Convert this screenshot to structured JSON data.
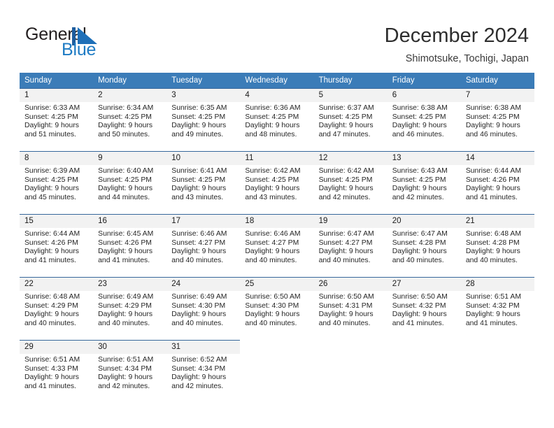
{
  "brand": {
    "name_part1": "General",
    "name_part2": "Blue",
    "logo_icon": "blue-triangle-flag-icon",
    "accent_color": "#1e7bc4"
  },
  "header": {
    "title": "December 2024",
    "subtitle": "Shimotsuke, Tochigi, Japan"
  },
  "theme": {
    "header_row_bg": "#3b7cb8",
    "day_number_bg": "#f2f2f2",
    "row_top_border": "#36679b",
    "page_bg": "#ffffff"
  },
  "weekday_headers": [
    "Sunday",
    "Monday",
    "Tuesday",
    "Wednesday",
    "Thursday",
    "Friday",
    "Saturday"
  ],
  "weeks": [
    [
      {
        "day": "1",
        "sunrise": "Sunrise: 6:33 AM",
        "sunset": "Sunset: 4:25 PM",
        "daylight1": "Daylight: 9 hours",
        "daylight2": "and 51 minutes."
      },
      {
        "day": "2",
        "sunrise": "Sunrise: 6:34 AM",
        "sunset": "Sunset: 4:25 PM",
        "daylight1": "Daylight: 9 hours",
        "daylight2": "and 50 minutes."
      },
      {
        "day": "3",
        "sunrise": "Sunrise: 6:35 AM",
        "sunset": "Sunset: 4:25 PM",
        "daylight1": "Daylight: 9 hours",
        "daylight2": "and 49 minutes."
      },
      {
        "day": "4",
        "sunrise": "Sunrise: 6:36 AM",
        "sunset": "Sunset: 4:25 PM",
        "daylight1": "Daylight: 9 hours",
        "daylight2": "and 48 minutes."
      },
      {
        "day": "5",
        "sunrise": "Sunrise: 6:37 AM",
        "sunset": "Sunset: 4:25 PM",
        "daylight1": "Daylight: 9 hours",
        "daylight2": "and 47 minutes."
      },
      {
        "day": "6",
        "sunrise": "Sunrise: 6:38 AM",
        "sunset": "Sunset: 4:25 PM",
        "daylight1": "Daylight: 9 hours",
        "daylight2": "and 46 minutes."
      },
      {
        "day": "7",
        "sunrise": "Sunrise: 6:38 AM",
        "sunset": "Sunset: 4:25 PM",
        "daylight1": "Daylight: 9 hours",
        "daylight2": "and 46 minutes."
      }
    ],
    [
      {
        "day": "8",
        "sunrise": "Sunrise: 6:39 AM",
        "sunset": "Sunset: 4:25 PM",
        "daylight1": "Daylight: 9 hours",
        "daylight2": "and 45 minutes."
      },
      {
        "day": "9",
        "sunrise": "Sunrise: 6:40 AM",
        "sunset": "Sunset: 4:25 PM",
        "daylight1": "Daylight: 9 hours",
        "daylight2": "and 44 minutes."
      },
      {
        "day": "10",
        "sunrise": "Sunrise: 6:41 AM",
        "sunset": "Sunset: 4:25 PM",
        "daylight1": "Daylight: 9 hours",
        "daylight2": "and 43 minutes."
      },
      {
        "day": "11",
        "sunrise": "Sunrise: 6:42 AM",
        "sunset": "Sunset: 4:25 PM",
        "daylight1": "Daylight: 9 hours",
        "daylight2": "and 43 minutes."
      },
      {
        "day": "12",
        "sunrise": "Sunrise: 6:42 AM",
        "sunset": "Sunset: 4:25 PM",
        "daylight1": "Daylight: 9 hours",
        "daylight2": "and 42 minutes."
      },
      {
        "day": "13",
        "sunrise": "Sunrise: 6:43 AM",
        "sunset": "Sunset: 4:25 PM",
        "daylight1": "Daylight: 9 hours",
        "daylight2": "and 42 minutes."
      },
      {
        "day": "14",
        "sunrise": "Sunrise: 6:44 AM",
        "sunset": "Sunset: 4:26 PM",
        "daylight1": "Daylight: 9 hours",
        "daylight2": "and 41 minutes."
      }
    ],
    [
      {
        "day": "15",
        "sunrise": "Sunrise: 6:44 AM",
        "sunset": "Sunset: 4:26 PM",
        "daylight1": "Daylight: 9 hours",
        "daylight2": "and 41 minutes."
      },
      {
        "day": "16",
        "sunrise": "Sunrise: 6:45 AM",
        "sunset": "Sunset: 4:26 PM",
        "daylight1": "Daylight: 9 hours",
        "daylight2": "and 41 minutes."
      },
      {
        "day": "17",
        "sunrise": "Sunrise: 6:46 AM",
        "sunset": "Sunset: 4:27 PM",
        "daylight1": "Daylight: 9 hours",
        "daylight2": "and 40 minutes."
      },
      {
        "day": "18",
        "sunrise": "Sunrise: 6:46 AM",
        "sunset": "Sunset: 4:27 PM",
        "daylight1": "Daylight: 9 hours",
        "daylight2": "and 40 minutes."
      },
      {
        "day": "19",
        "sunrise": "Sunrise: 6:47 AM",
        "sunset": "Sunset: 4:27 PM",
        "daylight1": "Daylight: 9 hours",
        "daylight2": "and 40 minutes."
      },
      {
        "day": "20",
        "sunrise": "Sunrise: 6:47 AM",
        "sunset": "Sunset: 4:28 PM",
        "daylight1": "Daylight: 9 hours",
        "daylight2": "and 40 minutes."
      },
      {
        "day": "21",
        "sunrise": "Sunrise: 6:48 AM",
        "sunset": "Sunset: 4:28 PM",
        "daylight1": "Daylight: 9 hours",
        "daylight2": "and 40 minutes."
      }
    ],
    [
      {
        "day": "22",
        "sunrise": "Sunrise: 6:48 AM",
        "sunset": "Sunset: 4:29 PM",
        "daylight1": "Daylight: 9 hours",
        "daylight2": "and 40 minutes."
      },
      {
        "day": "23",
        "sunrise": "Sunrise: 6:49 AM",
        "sunset": "Sunset: 4:29 PM",
        "daylight1": "Daylight: 9 hours",
        "daylight2": "and 40 minutes."
      },
      {
        "day": "24",
        "sunrise": "Sunrise: 6:49 AM",
        "sunset": "Sunset: 4:30 PM",
        "daylight1": "Daylight: 9 hours",
        "daylight2": "and 40 minutes."
      },
      {
        "day": "25",
        "sunrise": "Sunrise: 6:50 AM",
        "sunset": "Sunset: 4:30 PM",
        "daylight1": "Daylight: 9 hours",
        "daylight2": "and 40 minutes."
      },
      {
        "day": "26",
        "sunrise": "Sunrise: 6:50 AM",
        "sunset": "Sunset: 4:31 PM",
        "daylight1": "Daylight: 9 hours",
        "daylight2": "and 40 minutes."
      },
      {
        "day": "27",
        "sunrise": "Sunrise: 6:50 AM",
        "sunset": "Sunset: 4:32 PM",
        "daylight1": "Daylight: 9 hours",
        "daylight2": "and 41 minutes."
      },
      {
        "day": "28",
        "sunrise": "Sunrise: 6:51 AM",
        "sunset": "Sunset: 4:32 PM",
        "daylight1": "Daylight: 9 hours",
        "daylight2": "and 41 minutes."
      }
    ],
    [
      {
        "day": "29",
        "sunrise": "Sunrise: 6:51 AM",
        "sunset": "Sunset: 4:33 PM",
        "daylight1": "Daylight: 9 hours",
        "daylight2": "and 41 minutes."
      },
      {
        "day": "30",
        "sunrise": "Sunrise: 6:51 AM",
        "sunset": "Sunset: 4:34 PM",
        "daylight1": "Daylight: 9 hours",
        "daylight2": "and 42 minutes."
      },
      {
        "day": "31",
        "sunrise": "Sunrise: 6:52 AM",
        "sunset": "Sunset: 4:34 PM",
        "daylight1": "Daylight: 9 hours",
        "daylight2": "and 42 minutes."
      },
      {
        "day": "",
        "sunrise": "",
        "sunset": "",
        "daylight1": "",
        "daylight2": ""
      },
      {
        "day": "",
        "sunrise": "",
        "sunset": "",
        "daylight1": "",
        "daylight2": ""
      },
      {
        "day": "",
        "sunrise": "",
        "sunset": "",
        "daylight1": "",
        "daylight2": ""
      },
      {
        "day": "",
        "sunrise": "",
        "sunset": "",
        "daylight1": "",
        "daylight2": ""
      }
    ]
  ]
}
